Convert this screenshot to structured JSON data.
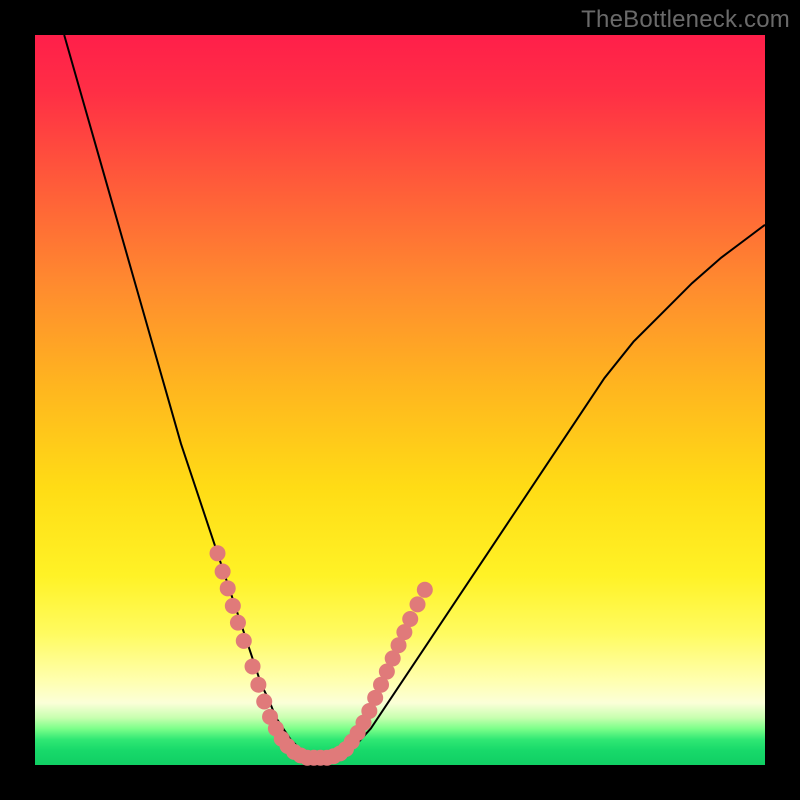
{
  "watermark": "TheBottleneck.com",
  "colors": {
    "frame_bg": "#000000",
    "curve_stroke": "#000000",
    "marker_fill": "#e07a7a",
    "gradient_top": "#ff1f4a",
    "gradient_bottom": "#10cf64"
  },
  "chart_data": {
    "type": "line",
    "title": "",
    "xlabel": "",
    "ylabel": "",
    "xlim": [
      0,
      100
    ],
    "ylim": [
      0,
      100
    ],
    "grid": false,
    "legend": false,
    "series": [
      {
        "name": "bottleneck-curve",
        "x": [
          4,
          6,
          8,
          10,
          12,
          14,
          16,
          18,
          20,
          22,
          24,
          25,
          26,
          27,
          28,
          29,
          30,
          31,
          32,
          33,
          34,
          35,
          36,
          37,
          38,
          39,
          40,
          42,
          44,
          46,
          48,
          50,
          54,
          58,
          62,
          66,
          70,
          74,
          78,
          82,
          86,
          90,
          94,
          98,
          100
        ],
        "y": [
          100,
          93,
          86,
          79,
          72,
          65,
          58,
          51,
          44,
          38,
          32,
          29,
          26,
          23,
          20,
          17,
          14,
          11,
          9,
          6.5,
          5,
          3.5,
          2.5,
          1.8,
          1.3,
          1,
          1,
          1.5,
          2.8,
          5,
          8,
          11,
          17,
          23,
          29,
          35,
          41,
          47,
          53,
          58,
          62,
          66,
          69.5,
          72.5,
          74
        ]
      }
    ],
    "markers": [
      {
        "x": 25.0,
        "y": 29.0
      },
      {
        "x": 25.7,
        "y": 26.5
      },
      {
        "x": 26.4,
        "y": 24.2
      },
      {
        "x": 27.1,
        "y": 21.8
      },
      {
        "x": 27.8,
        "y": 19.5
      },
      {
        "x": 28.6,
        "y": 17.0
      },
      {
        "x": 29.8,
        "y": 13.5
      },
      {
        "x": 30.6,
        "y": 11.0
      },
      {
        "x": 31.4,
        "y": 8.7
      },
      {
        "x": 32.2,
        "y": 6.6
      },
      {
        "x": 33.0,
        "y": 5.0
      },
      {
        "x": 33.8,
        "y": 3.6
      },
      {
        "x": 34.6,
        "y": 2.6
      },
      {
        "x": 35.5,
        "y": 1.8
      },
      {
        "x": 36.4,
        "y": 1.3
      },
      {
        "x": 37.3,
        "y": 1.0
      },
      {
        "x": 38.2,
        "y": 1.0
      },
      {
        "x": 39.1,
        "y": 1.0
      },
      {
        "x": 40.0,
        "y": 1.0
      },
      {
        "x": 40.9,
        "y": 1.2
      },
      {
        "x": 41.8,
        "y": 1.6
      },
      {
        "x": 42.6,
        "y": 2.2
      },
      {
        "x": 43.4,
        "y": 3.2
      },
      {
        "x": 44.2,
        "y": 4.4
      },
      {
        "x": 45.0,
        "y": 5.8
      },
      {
        "x": 45.8,
        "y": 7.4
      },
      {
        "x": 46.6,
        "y": 9.2
      },
      {
        "x": 47.4,
        "y": 11.0
      },
      {
        "x": 48.2,
        "y": 12.8
      },
      {
        "x": 49.0,
        "y": 14.6
      },
      {
        "x": 49.8,
        "y": 16.4
      },
      {
        "x": 50.6,
        "y": 18.2
      },
      {
        "x": 51.4,
        "y": 20.0
      },
      {
        "x": 52.4,
        "y": 22.0
      },
      {
        "x": 53.4,
        "y": 24.0
      }
    ]
  }
}
